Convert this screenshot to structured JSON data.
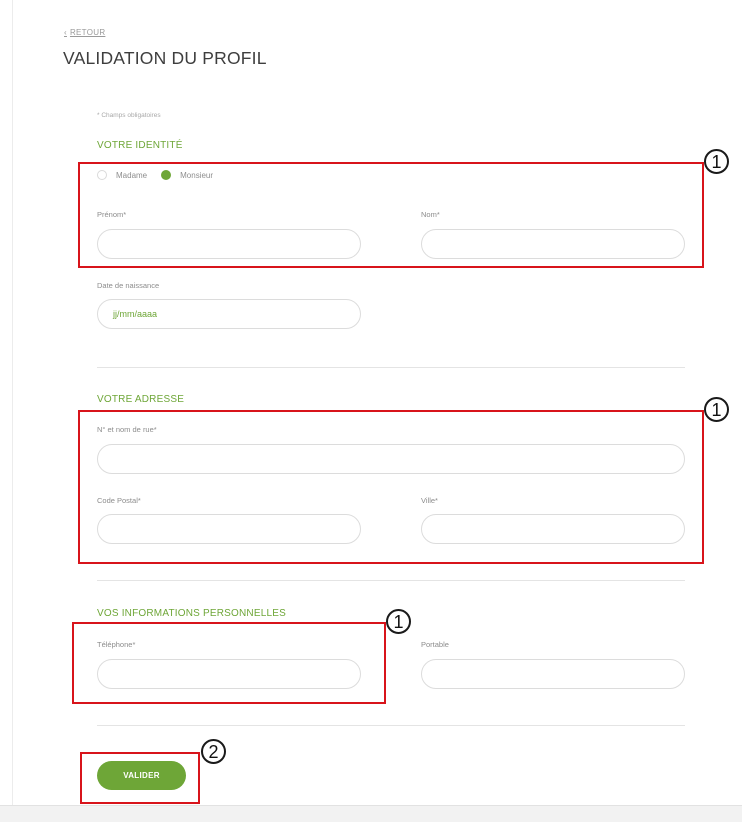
{
  "nav": {
    "back_label": "RETOUR"
  },
  "page": {
    "title": "VALIDATION DU PROFIL",
    "required_note": "* Champs obligatoires"
  },
  "identity": {
    "section_title": "VOTRE IDENTITÉ",
    "civility": {
      "options": [
        "Madame",
        "Monsieur"
      ],
      "selected": "Monsieur"
    },
    "first_name_label": "Prénom*",
    "last_name_label": "Nom*",
    "birthdate_label": "Date de naissance",
    "birthdate_placeholder": "jj/mm/aaaa"
  },
  "address": {
    "section_title": "VOTRE ADRESSE",
    "street_label": "N° et nom de rue*",
    "postal_code_label": "Code Postal*",
    "city_label": "Ville*"
  },
  "personal": {
    "section_title": "VOS INFORMATIONS PERSONNELLES",
    "phone_label": "Téléphone*",
    "mobile_label": "Portable"
  },
  "actions": {
    "submit_label": "VALIDER"
  },
  "annotations": {
    "identity_badge": "1",
    "address_badge": "1",
    "phone_badge": "1",
    "submit_badge": "2"
  },
  "colors": {
    "accent_green": "#6ea637",
    "annotation_red": "#d8141b"
  }
}
